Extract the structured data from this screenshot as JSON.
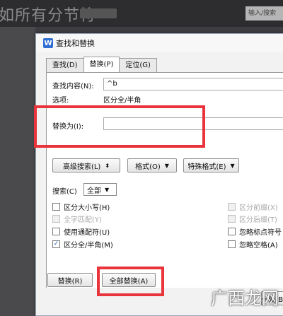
{
  "background": {
    "doc_title": "如所有分节符",
    "search_hint": "输入/搜索"
  },
  "dialog": {
    "title": "查找和替换",
    "icon_letter": "W",
    "tabs": [
      "查找(D)",
      "替换(P)",
      "定位(G)"
    ],
    "find_label": "查找内容(N):",
    "find_value": "^b",
    "options_label": "选项:",
    "options_value": "区分全/半角",
    "replace_label": "替换为(I):",
    "replace_value": "",
    "advanced_button": "高级搜索(L)",
    "format_button": "格式(O)",
    "special_button": "特殊格式(E)",
    "search_label": "搜索(C)",
    "search_value": "全部",
    "checkboxes_left": [
      {
        "label": "区分大小写(H)",
        "checked": false,
        "disabled": false
      },
      {
        "label": "全字匹配(Y)",
        "checked": false,
        "disabled": true
      },
      {
        "label": "使用通配符(U)",
        "checked": false,
        "disabled": false
      },
      {
        "label": "区分全/半角(M)",
        "checked": true,
        "disabled": false
      }
    ],
    "checkboxes_right": [
      {
        "label": "区分前缀(X)",
        "checked": false,
        "disabled": true
      },
      {
        "label": "区分后缀(T)",
        "checked": false,
        "disabled": true
      },
      {
        "label": "忽略标点符号",
        "checked": false,
        "disabled": false
      },
      {
        "label": "忽略空格(A)",
        "checked": false,
        "disabled": false
      }
    ],
    "replace_button": "替换(R)",
    "replace_all_button": "全部替换(A)",
    "partial_button_text": "一处(B)"
  },
  "watermark": "广西龙网",
  "colors": {
    "highlight": "#e8343a",
    "accent": "#2f6fd4"
  }
}
